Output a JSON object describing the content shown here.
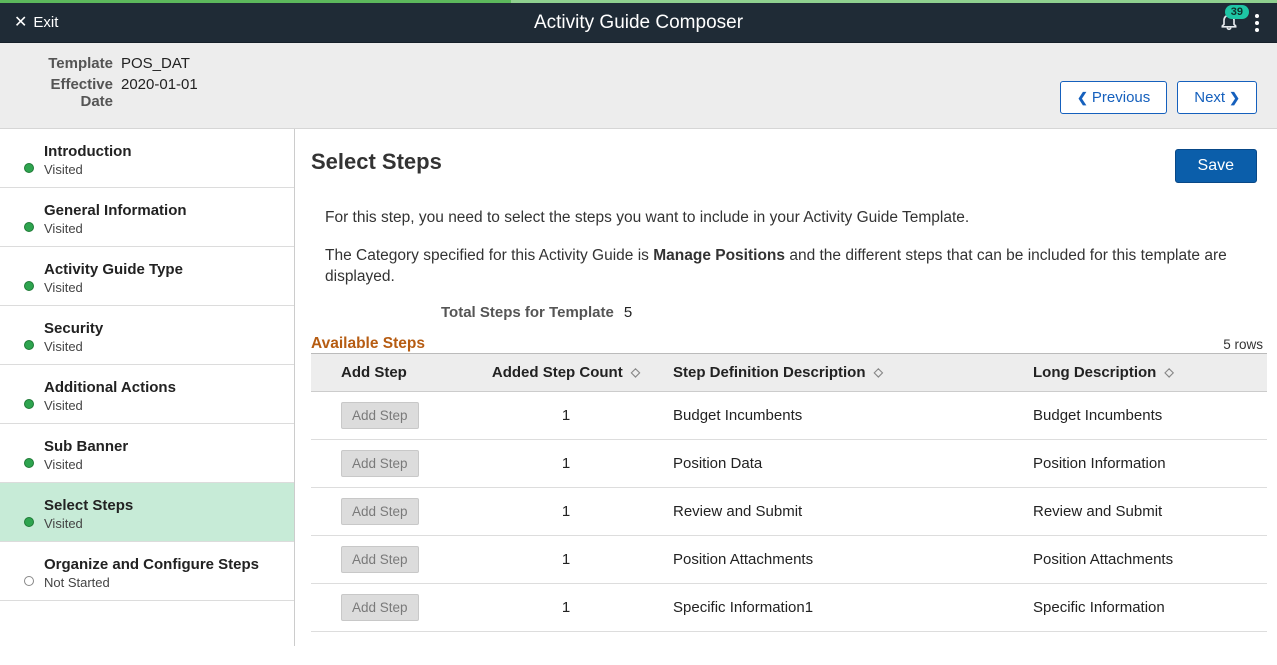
{
  "header": {
    "exit_label": "Exit",
    "title": "Activity Guide Composer",
    "notification_count": "39"
  },
  "infobar": {
    "template_label": "Template",
    "template_value": "POS_DAT",
    "effdt_label": "Effective Date",
    "effdt_value": "2020-01-01",
    "prev_label": "Previous",
    "next_label": "Next"
  },
  "sidebar": {
    "items": [
      {
        "title": "Introduction",
        "status": "Visited",
        "state": "visited"
      },
      {
        "title": "General Information",
        "status": "Visited",
        "state": "visited"
      },
      {
        "title": "Activity Guide Type",
        "status": "Visited",
        "state": "visited"
      },
      {
        "title": "Security",
        "status": "Visited",
        "state": "visited"
      },
      {
        "title": "Additional Actions",
        "status": "Visited",
        "state": "visited"
      },
      {
        "title": "Sub Banner",
        "status": "Visited",
        "state": "visited"
      },
      {
        "title": "Select Steps",
        "status": "Visited",
        "state": "visited"
      },
      {
        "title": "Organize and Configure Steps",
        "status": "Not Started",
        "state": "notstarted"
      }
    ],
    "current_index": 6
  },
  "main": {
    "title": "Select Steps",
    "save_label": "Save",
    "desc1": "For this step, you need to select the steps you want to include in your Activity Guide Template.",
    "desc2_pre": "The Category specified for this Activity Guide is ",
    "desc2_bold": "Manage Positions",
    "desc2_post": " and the different steps that can be included for this template are displayed.",
    "total_label": "Total Steps for Template",
    "total_value": "5",
    "section_label": "Available Steps",
    "rows_count": "5 rows",
    "columns": {
      "add_step": "Add Step",
      "added_count": "Added Step Count",
      "step_desc": "Step Definition Description",
      "long_desc": "Long Description"
    },
    "add_step_btn_label": "Add Step",
    "rows": [
      {
        "count": "1",
        "desc": "Budget Incumbents",
        "long": "Budget Incumbents"
      },
      {
        "count": "1",
        "desc": "Position Data",
        "long": "Position Information"
      },
      {
        "count": "1",
        "desc": "Review and Submit",
        "long": "Review and Submit"
      },
      {
        "count": "1",
        "desc": "Position Attachments",
        "long": "Position Attachments"
      },
      {
        "count": "1",
        "desc": "Specific Information1",
        "long": "Specific Information"
      }
    ]
  }
}
